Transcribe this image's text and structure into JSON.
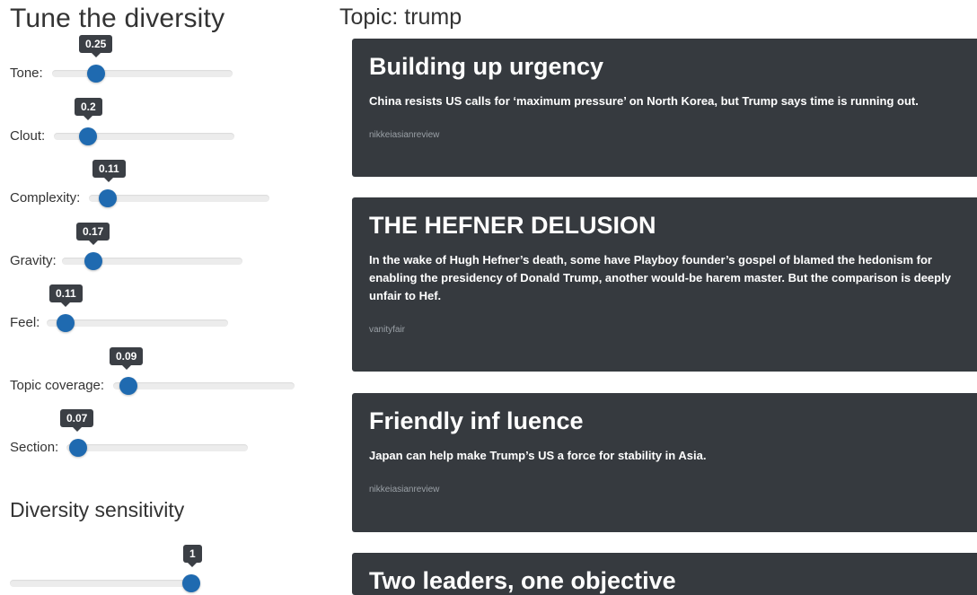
{
  "sidebar": {
    "title": "Tune the diversity",
    "sliders": [
      {
        "label": "Tone:",
        "value": "0.25",
        "fraction": 0.25
      },
      {
        "label": "Clout:",
        "value": "0.2",
        "fraction": 0.2
      },
      {
        "label": "Complexity:",
        "value": "0.11",
        "fraction": 0.11
      },
      {
        "label": "Gravity:",
        "value": "0.17",
        "fraction": 0.17
      },
      {
        "label": "Feel:",
        "value": "0.11",
        "fraction": 0.11
      },
      {
        "label": "Topic coverage:",
        "value": "0.09",
        "fraction": 0.09
      },
      {
        "label": "Section:",
        "value": "0.07",
        "fraction": 0.07
      }
    ],
    "sensitivity": {
      "title": "Diversity sensitivity",
      "value": "1",
      "fraction": 1.0
    }
  },
  "main": {
    "topic_title": "Topic: trump",
    "articles": [
      {
        "title": "Building up urgency",
        "description": "China resists US calls for ‘maximum pressure’ on North Korea, but Trump says time is running out.",
        "source": "nikkeiasianreview"
      },
      {
        "title": "THE HEFNER DELUSION",
        "description": "In the wake of Hugh Hefner’s death, some have Playboy founder’s gospel of blamed the hedonism for enabling the presidency of Donald Trump, another would-be harem master. But the comparison is deeply unfair to Hef.",
        "source": "vanityfair"
      },
      {
        "title": "Friendly inf luence",
        "description": "Japan can help make Trump’s US a force for stability in Asia.",
        "source": "nikkeiasianreview"
      },
      {
        "title": "Two leaders, one objective",
        "description": "",
        "source": ""
      }
    ]
  },
  "colors": {
    "card_bg": "#363a3f",
    "slider_knob": "#1f6ab0",
    "tooltip_bg": "#3b3f45"
  }
}
